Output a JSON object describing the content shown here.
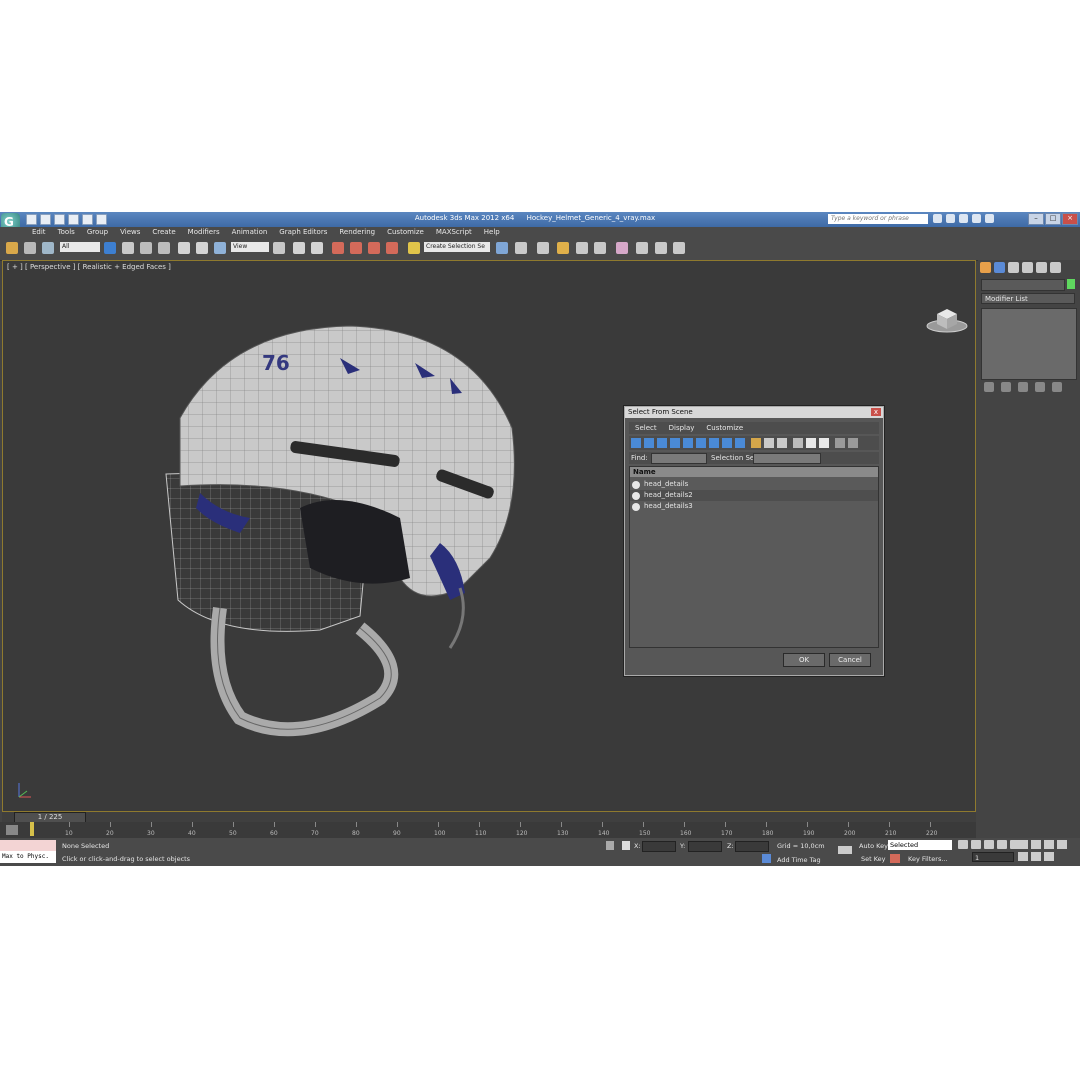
{
  "app": {
    "title": "Autodesk 3ds Max  2012 x64",
    "file_name": "Hockey_Helmet_Generic_4_vray.max",
    "search_placeholder": "Type a keyword or phrase",
    "logo": "G"
  },
  "menu": [
    "Edit",
    "Tools",
    "Group",
    "Views",
    "Create",
    "Modifiers",
    "Animation",
    "Graph Editors",
    "Rendering",
    "Customize",
    "MAXScript",
    "Help"
  ],
  "toolbar": {
    "selection_filter": "All",
    "reference_coord": "View",
    "named_selection": "Create Selection Se"
  },
  "viewport": {
    "label": "[ + ] [ Perspective ] [ Realistic + Edged Faces ]",
    "helmet_number": "76"
  },
  "dialog": {
    "title": "Select From Scene",
    "menu": [
      "Select",
      "Display",
      "Customize"
    ],
    "find_label": "Find:",
    "selection_set_label": "Selection Set:",
    "column_name": "Name",
    "items": [
      "head_details",
      "head_details2",
      "head_details3"
    ],
    "ok_label": "OK",
    "cancel_label": "Cancel",
    "close_glyph": "x"
  },
  "command_panel": {
    "modifier_list": "Modifier List"
  },
  "timeline": {
    "frame_readout": "1 / 225",
    "ticks": [
      "10",
      "20",
      "30",
      "40",
      "50",
      "60",
      "70",
      "80",
      "90",
      "100",
      "110",
      "120",
      "130",
      "140",
      "150",
      "160",
      "170",
      "180",
      "190",
      "200",
      "210",
      "220"
    ]
  },
  "status": {
    "maxscript_text": "Max to Physc.",
    "selection_status": "None Selected",
    "prompt": "Click or click-and-drag to select objects",
    "x_label": "X:",
    "y_label": "Y:",
    "z_label": "Z:",
    "grid": "Grid = 10,0cm",
    "add_time_tag": "Add Time Tag",
    "auto_key": "Auto Key",
    "set_key": "Set Key",
    "key_mode": "Selected",
    "key_filters": "Key Filters...",
    "current_frame": "1"
  }
}
